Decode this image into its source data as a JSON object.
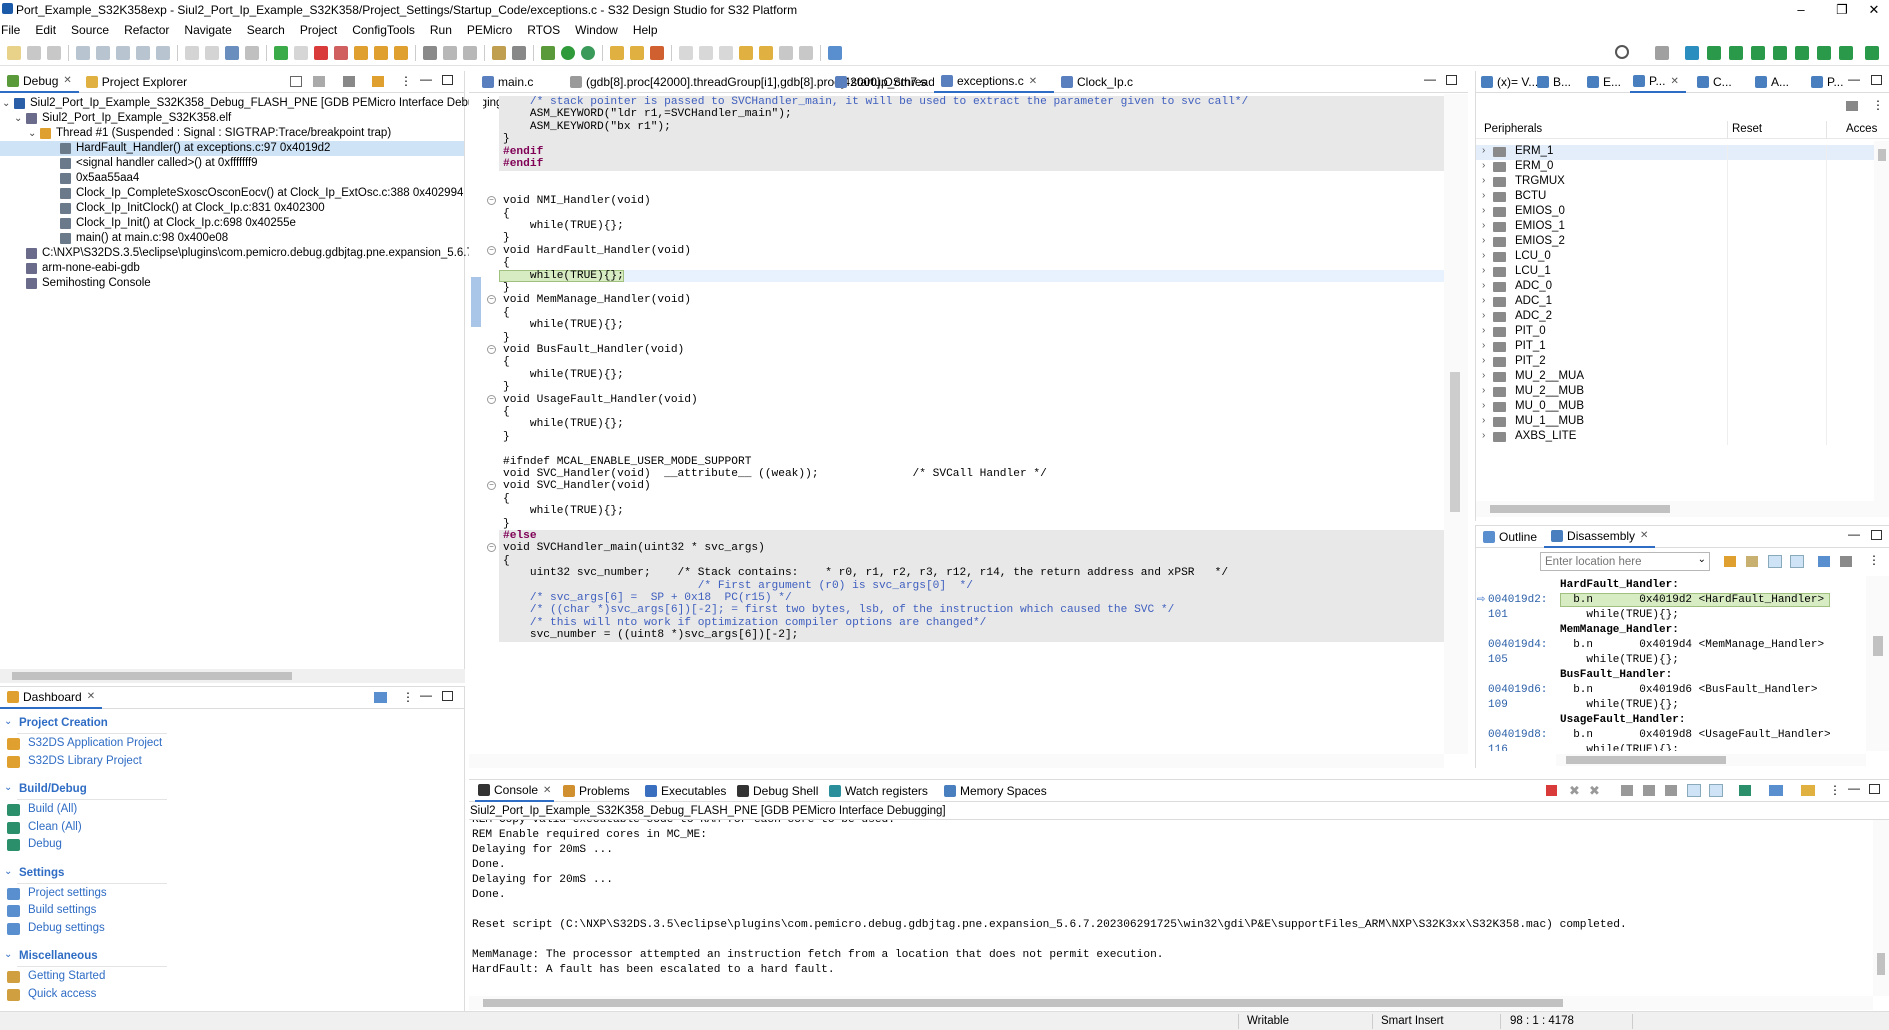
{
  "window": {
    "title": "Port_Example_S32K358exp - Siul2_Port_Ip_Example_S32K358/Project_Settings/Startup_Code/exceptions.c - S32 Design Studio for S32 Platform",
    "min": "–",
    "max": "❐",
    "close": "✕"
  },
  "menu": [
    "File",
    "Edit",
    "Source",
    "Refactor",
    "Navigate",
    "Search",
    "Project",
    "ConfigTools",
    "Run",
    "PEMicro",
    "RTOS",
    "Window",
    "Help"
  ],
  "debug_view": {
    "tabs": [
      "Debug",
      "Project Explorer"
    ],
    "tree": [
      {
        "text": "Siul2_Port_Ip_Example_S32K358_Debug_FLASH_PNE [GDB PEMicro Interface Debugging]",
        "indent": 0
      },
      {
        "text": "Siul2_Port_Ip_Example_S32K358.elf",
        "indent": 1
      },
      {
        "text": "Thread #1 (Suspended : Signal : SIGTRAP:Trace/breakpoint trap)",
        "indent": 2
      },
      {
        "text": "HardFault_Handler() at exceptions.c:97 0x4019d2",
        "indent": 3,
        "selected": true
      },
      {
        "text": "<signal handler called>() at 0xfffffff9",
        "indent": 3
      },
      {
        "text": "0x5aa55aa4",
        "indent": 3
      },
      {
        "text": "Clock_Ip_CompleteSxoscOsconEocv() at Clock_Ip_ExtOsc.c:388 0x402994",
        "indent": 3
      },
      {
        "text": "Clock_Ip_InitClock() at Clock_Ip.c:831 0x402300",
        "indent": 3
      },
      {
        "text": "Clock_Ip_Init() at Clock_Ip.c:698 0x40255e",
        "indent": 3
      },
      {
        "text": "main() at main.c:98 0x400e08",
        "indent": 3
      },
      {
        "text": "C:\\NXP\\S32DS.3.5\\eclipse\\plugins\\com.pemicro.debug.gdbjtag.pne.expansion_5.6.7",
        "indent": 1
      },
      {
        "text": "arm-none-eabi-gdb",
        "indent": 1
      },
      {
        "text": "Semihosting Console",
        "indent": 1
      }
    ]
  },
  "dashboard": {
    "tab": "Dashboard",
    "sections": [
      {
        "title": "Project Creation",
        "items": [
          "S32DS Application Project",
          "S32DS Library Project"
        ]
      },
      {
        "title": "Build/Debug",
        "items": [
          "Build  (All)",
          "Clean  (All)",
          "Debug"
        ]
      },
      {
        "title": "Settings",
        "items": [
          "Project settings",
          "Build settings",
          "Debug settings"
        ]
      },
      {
        "title": "Miscellaneous",
        "items": [
          "Getting Started",
          "Quick access"
        ]
      }
    ]
  },
  "editor": {
    "tabs": [
      "main.c",
      "(gdb[8].proc[42000].threadGroup[i1],gdb[8].proc[42000].OSthread[1]).thread[1].frame[0]",
      "startup_cm7.s",
      "exceptions.c",
      "Clock_Ip.c"
    ],
    "active_tab": 3,
    "lines": [
      {
        "t": "    /* stack pointer is passed to SVCHandler_main, it will be used to extract the parameter given to svc call*/",
        "c": "cm",
        "g": true
      },
      {
        "t": "    ASM_KEYWORD(\"ldr r1,=SVCHandler_main\");",
        "g": true
      },
      {
        "t": "    ASM_KEYWORD(\"bx r1\");",
        "g": true
      },
      {
        "t": "}",
        "g": true
      },
      {
        "t": "#endif",
        "c": "pp",
        "g": true
      },
      {
        "t": "#endif",
        "c": "pp",
        "g": true
      },
      {
        "t": ""
      },
      {
        "t": ""
      },
      {
        "t": "void NMI_Handler(void)",
        "fold": true
      },
      {
        "t": "{"
      },
      {
        "t": "    while(TRUE){};"
      },
      {
        "t": "}"
      },
      {
        "t": "void HardFault_Handler(void)",
        "fold": true
      },
      {
        "t": "{"
      },
      {
        "t": "    while(TRUE){};",
        "hl": true
      },
      {
        "t": "}"
      },
      {
        "t": "void MemManage_Handler(void)",
        "fold": true
      },
      {
        "t": "{"
      },
      {
        "t": "    while(TRUE){};"
      },
      {
        "t": "}"
      },
      {
        "t": "void BusFault_Handler(void)",
        "fold": true
      },
      {
        "t": "{"
      },
      {
        "t": "    while(TRUE){};"
      },
      {
        "t": "}"
      },
      {
        "t": "void UsageFault_Handler(void)",
        "fold": true
      },
      {
        "t": "{"
      },
      {
        "t": "    while(TRUE){};"
      },
      {
        "t": "}"
      },
      {
        "t": ""
      },
      {
        "t": "#ifndef MCAL_ENABLE_USER_MODE_SUPPORT"
      },
      {
        "t": "void SVC_Handler(void)  __attribute__ ((weak));              /* SVCall Handler */"
      },
      {
        "t": "void SVC_Handler(void)",
        "fold": true
      },
      {
        "t": "{"
      },
      {
        "t": "    while(TRUE){};"
      },
      {
        "t": "}"
      },
      {
        "t": "#else",
        "c": "pp",
        "g": true
      },
      {
        "t": "void SVCHandler_main(uint32 * svc_args)",
        "fold": true,
        "g": true
      },
      {
        "t": "{",
        "g": true
      },
      {
        "t": "    uint32 svc_number;    /* Stack contains:    * r0, r1, r2, r3, r12, r14, the return address and xPSR   */",
        "g": true
      },
      {
        "t": "                             /* First argument (r0) is svc_args[0]  */",
        "c": "cm",
        "g": true
      },
      {
        "t": "    /* svc_args[6] =  SP + 0x18  PC(r15) */",
        "c": "cm",
        "g": true
      },
      {
        "t": "    /* ((char *)svc_args[6])[-2]; = first two bytes, lsb, of the instruction which caused the SVC */",
        "c": "cm",
        "g": true
      },
      {
        "t": "    /* this will nto work if optimization compiler options are changed*/",
        "c": "cm",
        "g": true
      },
      {
        "t": "    svc_number = ((uint8 *)svc_args[6])[-2];",
        "g": true
      }
    ]
  },
  "peripherals": {
    "tabs": [
      "(x)= V...",
      "B...",
      "E...",
      "P...",
      "C...",
      "A...",
      "P..."
    ],
    "columns": [
      "Peripherals",
      "Reset",
      "Acces"
    ],
    "items": [
      "ERM_1",
      "ERM_0",
      "TRGMUX",
      "BCTU",
      "EMIOS_0",
      "EMIOS_1",
      "EMIOS_2",
      "LCU_0",
      "LCU_1",
      "ADC_0",
      "ADC_1",
      "ADC_2",
      "PIT_0",
      "PIT_1",
      "PIT_2",
      "MU_2__MUA",
      "MU_2__MUB",
      "MU_0__MUB",
      "MU_1__MUB",
      "AXBS_LITE"
    ]
  },
  "disassembly": {
    "tabs": [
      "Outline",
      "Disassembly"
    ],
    "location_placeholder": "Enter location here",
    "rows": [
      {
        "addr": "",
        "code": "HardFault_Handler:",
        "bold": true
      },
      {
        "addr": "004019d2:",
        "code": "  b.n       0x4019d2 <HardFault_Handler>",
        "current": true
      },
      {
        "addr": "101",
        "code": "    while(TRUE){};"
      },
      {
        "addr": "",
        "code": "MemManage_Handler:",
        "bold": true
      },
      {
        "addr": "004019d4:",
        "code": "  b.n       0x4019d4 <MemManage_Handler>"
      },
      {
        "addr": "105",
        "code": "    while(TRUE){};"
      },
      {
        "addr": "",
        "code": "BusFault_Handler:",
        "bold": true
      },
      {
        "addr": "004019d6:",
        "code": "  b.n       0x4019d6 <BusFault_Handler>"
      },
      {
        "addr": "109",
        "code": "    while(TRUE){};"
      },
      {
        "addr": "",
        "code": "UsageFault_Handler:",
        "bold": true
      },
      {
        "addr": "004019d8:",
        "code": "  b.n       0x4019d8 <UsageFault_Handler>"
      },
      {
        "addr": "116",
        "code": "    while(TRUE){};"
      }
    ]
  },
  "console": {
    "tabs": [
      "Console",
      "Problems",
      "Executables",
      "Debug Shell",
      "Watch registers",
      "Memory Spaces"
    ],
    "header": "Siul2_Port_Ip_Example_S32K358_Debug_FLASH_PNE [GDB PEMicro Interface Debugging]",
    "lines": [
      "REM Copy valid executable code to RAM for each core to be used.",
      "REM Enable required cores in MC_ME:",
      "Delaying for 20mS ...",
      "Done.",
      "Delaying for 20mS ...",
      "Done.",
      "",
      "Reset script (C:\\NXP\\S32DS.3.5\\eclipse\\plugins\\com.pemicro.debug.gdbjtag.pne.expansion_5.6.7.202306291725\\win32\\gdi\\P&E\\supportFiles_ARM\\NXP\\S32K3xx\\S32K358.mac) completed.",
      "",
      "MemManage: The processor attempted an instruction fetch from a location that does not permit execution.",
      "HardFault: A fault has been escalated to a hard fault."
    ]
  },
  "status": {
    "writable": "Writable",
    "insert": "Smart Insert",
    "position": "98 : 1 : 4178"
  },
  "colors": {
    "accent": "#2f6cc4",
    "selection": "#cfe3f7",
    "current_line": "#e8f2fe",
    "debug_line": "#d8ecc4",
    "gray_code": "#e8e8e8"
  }
}
